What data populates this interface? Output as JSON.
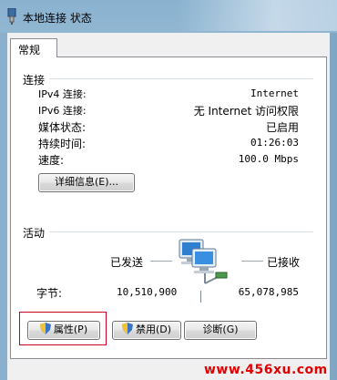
{
  "window": {
    "title": "本地连接 状态"
  },
  "tabs": [
    {
      "label": "常规"
    }
  ],
  "connection": {
    "group_title": "连接",
    "rows": [
      {
        "label": "IPv4 连接:",
        "value": "Internet"
      },
      {
        "label": "IPv6 连接:",
        "value": "无 Internet 访问权限"
      },
      {
        "label": "媒体状态:",
        "value": "已启用"
      },
      {
        "label": "持续时间:",
        "value": "01:26:03"
      },
      {
        "label": "速度:",
        "value": "100.0 Mbps"
      }
    ],
    "details_button": "详细信息(E)..."
  },
  "activity": {
    "group_title": "活动",
    "sent_label": "已发送",
    "received_label": "已接收",
    "bytes_label": "字节:",
    "bytes_sent": "10,510,900",
    "bytes_received": "65,078,985"
  },
  "buttons": {
    "properties": "属性(P)",
    "disable": "禁用(D)",
    "diagnose": "诊断(G)"
  },
  "watermark": "www.456xu.com"
}
